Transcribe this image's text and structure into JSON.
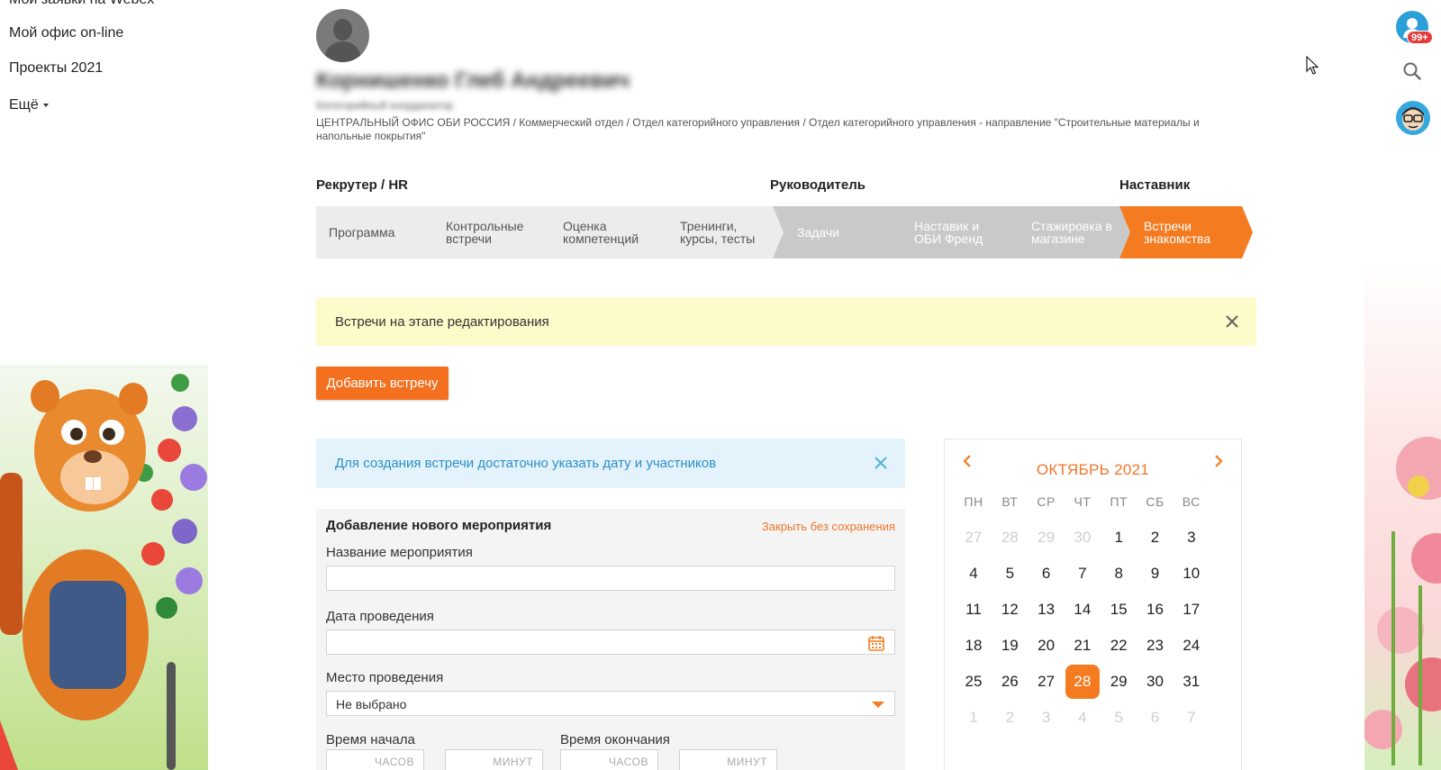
{
  "nav": {
    "items": [
      {
        "label": "Мои заявки на Webex"
      },
      {
        "label": "Мой офис on-line"
      },
      {
        "label": "Проекты 2021"
      }
    ],
    "more_label": "Ещё"
  },
  "rail": {
    "notifications_badge": "99+",
    "icons": [
      "user-avatar-icon",
      "search-icon",
      "bot-avatar-icon"
    ]
  },
  "profile": {
    "name": "Корнишенко Глеб Андреевич",
    "role": "Категорийный координатор",
    "org_path": "ЦЕНТРАЛЬНЫЙ ОФИС ОБИ РОССИЯ / Коммерческий отдел / Отдел категорийного управления / Отдел категорийного управления - направление \"Строительные материалы и напольные покрытия\""
  },
  "stage_headers": [
    "Рекрутер / HR",
    "Руководитель",
    "Наставник"
  ],
  "steps": [
    {
      "label": "Программа",
      "state": "light"
    },
    {
      "label": "Контрольные встречи",
      "state": "light"
    },
    {
      "label": "Оценка компетенций",
      "state": "light"
    },
    {
      "label": "Тренинги, курсы, тесты",
      "state": "light"
    },
    {
      "label": "Задачи",
      "state": "mid"
    },
    {
      "label": "Наставик и ОБИ Френд",
      "state": "mid"
    },
    {
      "label": "Стажировка в магазине",
      "state": "mid"
    },
    {
      "label": "Встречи знакомства",
      "state": "active"
    }
  ],
  "alerts": {
    "editing": "Встречи на этапе редактирования",
    "hint": "Для создания встречи достаточно указать дату и участников"
  },
  "add_button_label": "Добавить встречу",
  "form": {
    "title": "Добавление нового мероприятия",
    "close_label": "Закрыть без сохранения",
    "name_label": "Название мероприятия",
    "name_value": "",
    "date_label": "Дата проведения",
    "date_value": "",
    "place_label": "Место проведения",
    "place_value": "Не выбрано",
    "start_label": "Время начала",
    "end_label": "Время окончания",
    "hours_placeholder": "ЧАСОВ",
    "minutes_placeholder": "МИНУТ"
  },
  "calendar": {
    "title": "ОКТЯБРЬ 2021",
    "weekdays": [
      "ПН",
      "ВТ",
      "СР",
      "ЧТ",
      "ПТ",
      "СБ",
      "ВС"
    ],
    "weeks": [
      [
        {
          "d": "27",
          "dim": true
        },
        {
          "d": "28",
          "dim": true
        },
        {
          "d": "29",
          "dim": true
        },
        {
          "d": "30",
          "dim": true
        },
        {
          "d": "1"
        },
        {
          "d": "2"
        },
        {
          "d": "3"
        }
      ],
      [
        {
          "d": "4"
        },
        {
          "d": "5"
        },
        {
          "d": "6"
        },
        {
          "d": "7"
        },
        {
          "d": "8"
        },
        {
          "d": "9"
        },
        {
          "d": "10"
        }
      ],
      [
        {
          "d": "11"
        },
        {
          "d": "12"
        },
        {
          "d": "13"
        },
        {
          "d": "14"
        },
        {
          "d": "15"
        },
        {
          "d": "16"
        },
        {
          "d": "17"
        }
      ],
      [
        {
          "d": "18"
        },
        {
          "d": "19"
        },
        {
          "d": "20"
        },
        {
          "d": "21"
        },
        {
          "d": "22"
        },
        {
          "d": "23"
        },
        {
          "d": "24"
        }
      ],
      [
        {
          "d": "25"
        },
        {
          "d": "26"
        },
        {
          "d": "27"
        },
        {
          "d": "28",
          "selected": true
        },
        {
          "d": "29"
        },
        {
          "d": "30"
        },
        {
          "d": "31"
        }
      ],
      [
        {
          "d": "1",
          "dim": true
        },
        {
          "d": "2",
          "dim": true
        },
        {
          "d": "3",
          "dim": true
        },
        {
          "d": "4",
          "dim": true
        },
        {
          "d": "5",
          "dim": true
        },
        {
          "d": "6",
          "dim": true
        },
        {
          "d": "7",
          "dim": true
        }
      ]
    ]
  },
  "colors": {
    "accent": "#f57b20",
    "link": "#2a8fc7",
    "alert_yellow": "#fdfbc9",
    "alert_blue": "#e4f3fb"
  }
}
